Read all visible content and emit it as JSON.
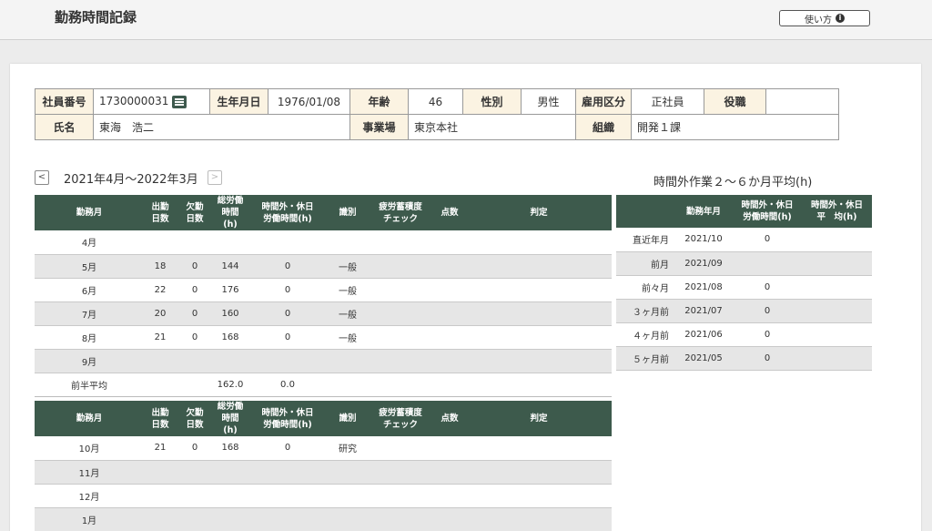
{
  "header": {
    "title": "勤務時間記録",
    "help_label": "使い方"
  },
  "employee": {
    "id_label": "社員番号",
    "id": "1730000031",
    "dob_label": "生年月日",
    "dob": "1976/01/08",
    "age_label": "年齢",
    "age": "46",
    "sex_label": "性別",
    "sex": "男性",
    "employment_label": "雇用区分",
    "employment": "正社員",
    "position_label": "役職",
    "position": "",
    "name_label": "氏名",
    "name": "東海　浩二",
    "site_label": "事業場",
    "site": "東京本社",
    "org_label": "組織",
    "org": "開発１課"
  },
  "period": {
    "prev": "<",
    "next": ">",
    "label": "2021年4月～2022年3月"
  },
  "headers": {
    "month": "勤務月",
    "attend": [
      "出勤",
      "日数"
    ],
    "absent": [
      "欠勤",
      "日数"
    ],
    "total": [
      "総労働",
      "時間(h)"
    ],
    "ot": [
      "時間外・休日",
      "労働時間(h)"
    ],
    "type": "識別",
    "fatigue": [
      "疲労蓄積度",
      "チェック"
    ],
    "score": "点数",
    "judge": "判定"
  },
  "first_half": [
    {
      "month": "4月",
      "attend": "",
      "absent": "",
      "total": "",
      "ot": "",
      "type": ""
    },
    {
      "month": "5月",
      "attend": "18",
      "absent": "0",
      "total": "144",
      "ot": "0",
      "type": "一般"
    },
    {
      "month": "6月",
      "attend": "22",
      "absent": "0",
      "total": "176",
      "ot": "0",
      "type": "一般"
    },
    {
      "month": "7月",
      "attend": "20",
      "absent": "0",
      "total": "160",
      "ot": "0",
      "type": "一般"
    },
    {
      "month": "8月",
      "attend": "21",
      "absent": "0",
      "total": "168",
      "ot": "0",
      "type": "一般"
    },
    {
      "month": "9月",
      "attend": "",
      "absent": "",
      "total": "",
      "ot": "",
      "type": ""
    }
  ],
  "first_half_avg": {
    "label": "前半平均",
    "total": "162.0",
    "ot": "0.0"
  },
  "second_half": [
    {
      "month": "10月",
      "attend": "21",
      "absent": "0",
      "total": "168",
      "ot": "0",
      "type": "研究"
    },
    {
      "month": "11月",
      "attend": "",
      "absent": "",
      "total": "",
      "ot": "",
      "type": ""
    },
    {
      "month": "12月",
      "attend": "",
      "absent": "",
      "total": "",
      "ot": "",
      "type": ""
    },
    {
      "month": "1月",
      "attend": "",
      "absent": "",
      "total": "",
      "ot": "",
      "type": ""
    }
  ],
  "overtime": {
    "title": "時間外作業２～６か月平均(h)",
    "headers": {
      "ym": "勤務年月",
      "ot": [
        "時間外・休日",
        "労働時間(h)"
      ],
      "avg": [
        "時間外・休日",
        "平　均(h)"
      ]
    },
    "rows": [
      {
        "label": "直近年月",
        "ym": "2021/10",
        "ot": "0",
        "avg": ""
      },
      {
        "label": "前月",
        "ym": "2021/09",
        "ot": "",
        "avg": ""
      },
      {
        "label": "前々月",
        "ym": "2021/08",
        "ot": "0",
        "avg": ""
      },
      {
        "label": "３ヶ月前",
        "ym": "2021/07",
        "ot": "0",
        "avg": ""
      },
      {
        "label": "４ヶ月前",
        "ym": "2021/06",
        "ot": "0",
        "avg": ""
      },
      {
        "label": "５ヶ月前",
        "ym": "2021/05",
        "ot": "0",
        "avg": ""
      }
    ]
  }
}
